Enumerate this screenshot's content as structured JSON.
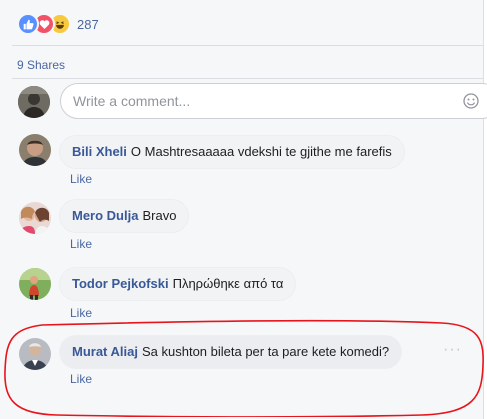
{
  "reactions": {
    "icons": [
      "like-icon",
      "love-icon",
      "haha-icon"
    ],
    "count": "287"
  },
  "shares": "9 Shares",
  "composer": {
    "placeholder": "Write a comment..."
  },
  "comments": [
    {
      "author": "Bili Xheli",
      "text": "O Mashtresaaaaa vdekshi te gjithe me farefis",
      "like_label": "Like"
    },
    {
      "author": "Mero Dulja",
      "text": "Bravo",
      "like_label": "Like"
    },
    {
      "author": "Todor Pejkofski",
      "text": "Πληρώθηκε από τα",
      "like_label": "Like"
    },
    {
      "author": "Murat Aliaj",
      "text": "Sa kushton bileta per ta pare kete komedi?",
      "like_label": "Like",
      "more_label": "···"
    }
  ],
  "colors": {
    "link": "#385898",
    "meta": "#4b67a1",
    "annotation": "#e8141c"
  }
}
